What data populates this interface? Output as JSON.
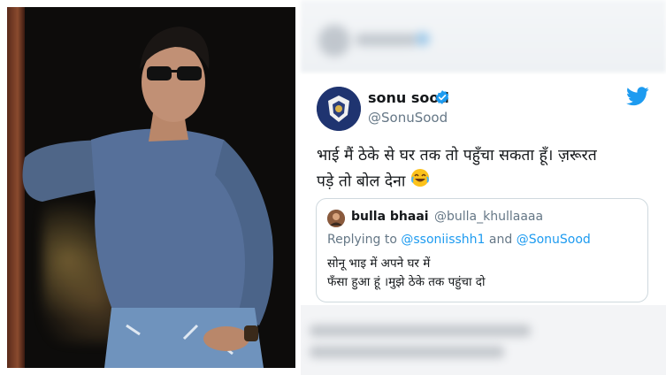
{
  "tweet": {
    "display_name": "sonu sood",
    "handle": "@SonuSood",
    "text_line1": "भाई मैं ठेके से घर तक तो पहुँचा सकता हूँ।  ज़रूरत",
    "text_line2": "पड़े तो बोल देना",
    "emoji": "😂"
  },
  "quoted_tweet": {
    "display_name": "bulla bhaai",
    "handle": "@bulla_khullaaaa",
    "replying_prefix": "Replying to ",
    "replying_user1": "@ssoniisshh1",
    "replying_and": " and ",
    "replying_user2": "@SonuSood",
    "text_line1": "सोनू भाइ में अपने घर में",
    "text_line2": "फँसा हुआ हूं ।मुझे ठेके तक पहुंचा दो"
  },
  "icons": {
    "verified": "verified-badge-icon",
    "twitter": "twitter-bird-icon"
  },
  "colors": {
    "twitter_blue": "#1d9bf0",
    "text": "#14171a",
    "muted": "#657786"
  }
}
